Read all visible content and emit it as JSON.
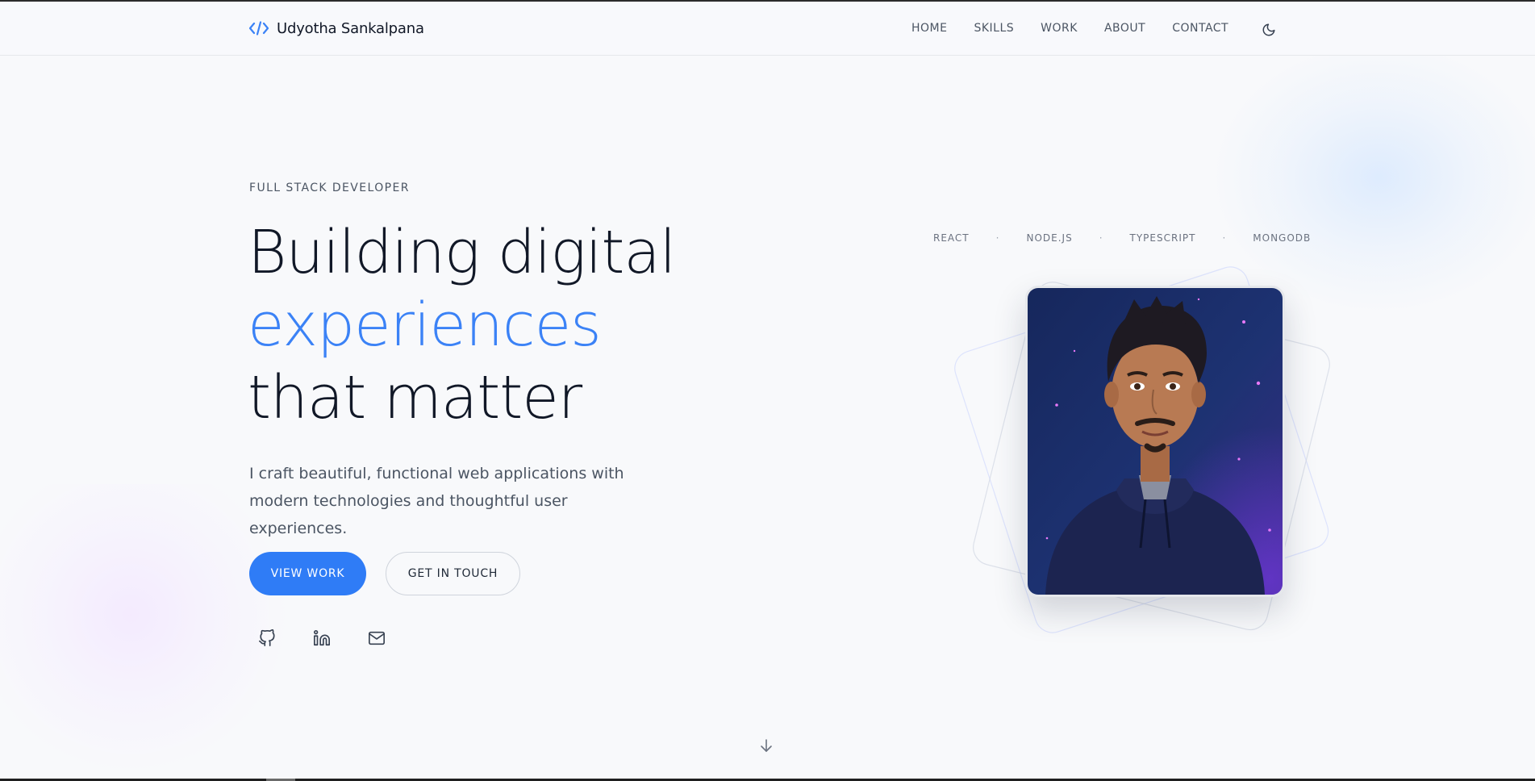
{
  "brand": {
    "name": "Udyotha Sankalpana",
    "icon": "code-icon"
  },
  "nav": {
    "links": [
      "HOME",
      "SKILLS",
      "WORK",
      "ABOUT",
      "CONTACT"
    ],
    "theme_icon": "moon-icon"
  },
  "hero": {
    "eyebrow": "FULL STACK DEVELOPER",
    "headline_line1": "Building digital",
    "headline_line2": "experiences",
    "headline_line3": "that matter",
    "subtext": "I craft beautiful, functional web applications with modern technologies and thoughtful user experiences.",
    "primary_button": "VIEW WORK",
    "secondary_button": "GET IN TOUCH",
    "socials": [
      "github-icon",
      "linkedin-icon",
      "mail-icon"
    ]
  },
  "tech_stack": [
    "REACT",
    "NODE.JS",
    "TYPESCRIPT",
    "MONGODB"
  ],
  "tech_separator": "·",
  "colors": {
    "accent": "#3b82f6",
    "background": "#f8f9fb",
    "text": "#111827",
    "muted": "#4b5563"
  }
}
